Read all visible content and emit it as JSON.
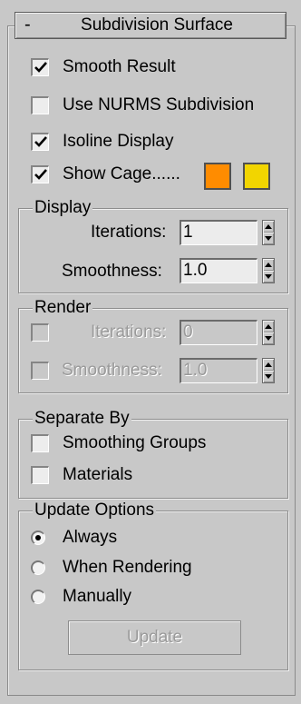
{
  "rollout": {
    "collapse_symbol": "-",
    "title": "Subdivision Surface",
    "smooth_result": {
      "label": "Smooth Result",
      "checked": true
    },
    "use_nurms": {
      "label": "Use NURMS Subdivision",
      "checked": false
    },
    "isoline_display": {
      "label": "Isoline Display",
      "checked": true
    },
    "show_cage": {
      "label": "Show Cage......",
      "checked": true
    },
    "cage_colors": {
      "first": "#ff8c00",
      "second": "#f2d500"
    }
  },
  "display": {
    "title": "Display",
    "iterations_label": "Iterations:",
    "iterations_value": "1",
    "smoothness_label": "Smoothness:",
    "smoothness_value": "1.0"
  },
  "render": {
    "title": "Render",
    "iterations_label": "Iterations:",
    "iterations_value": "0",
    "smoothness_label": "Smoothness:",
    "smoothness_value": "1.0"
  },
  "separate_by": {
    "title": "Separate By",
    "smoothing_groups": "Smoothing Groups",
    "materials": "Materials"
  },
  "update_options": {
    "title": "Update Options",
    "always": "Always",
    "when_rendering": "When Rendering",
    "manually": "Manually",
    "selected": "always",
    "update_button": "Update"
  }
}
